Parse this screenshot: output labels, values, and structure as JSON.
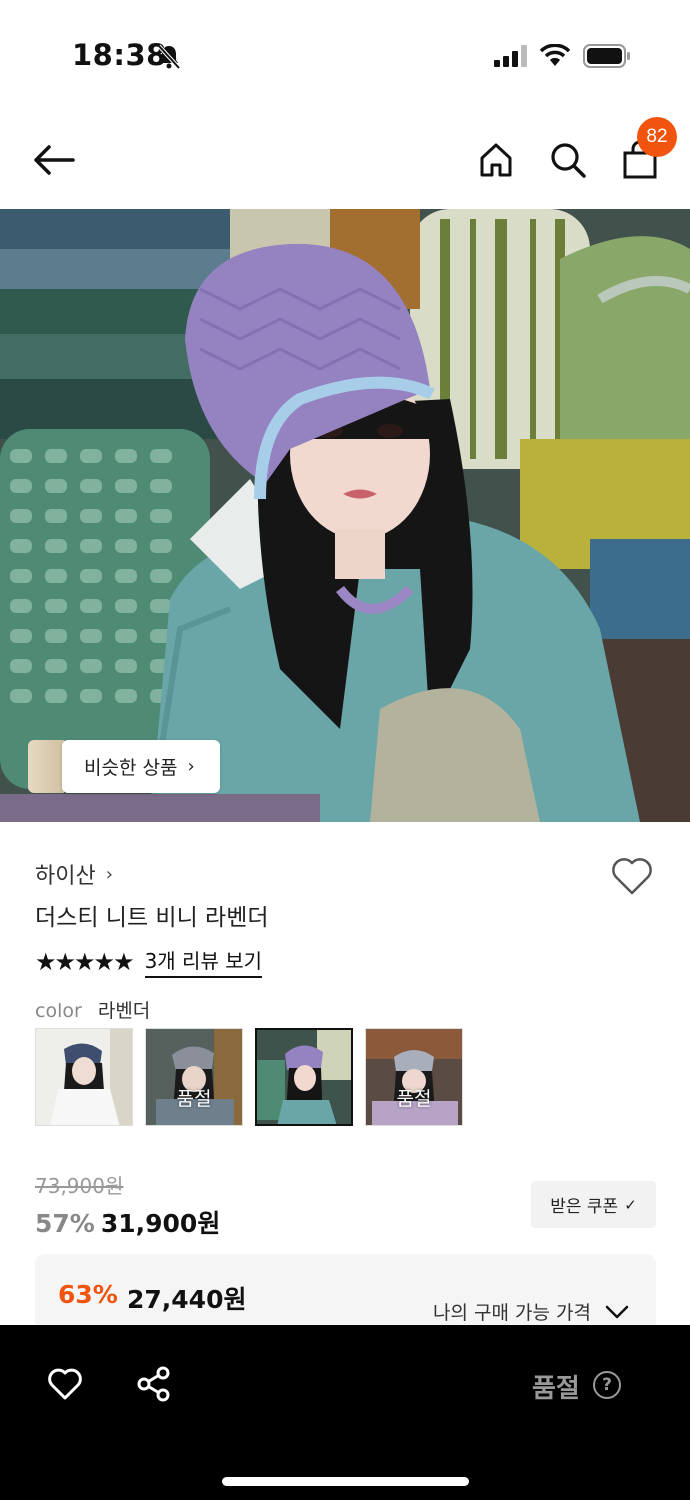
{
  "status_bar": {
    "time": "18:38",
    "icons": [
      "bell-slash-icon",
      "signal-icon",
      "wifi-icon",
      "battery-icon"
    ]
  },
  "nav": {
    "icons": [
      "back-arrow-icon",
      "home-icon",
      "search-icon",
      "shopping-bag-icon"
    ],
    "cart_count": "82"
  },
  "hero": {
    "similar_button": "비슷한 상품"
  },
  "product": {
    "brand": "하이산",
    "name": "더스티 니트 비니 라벤더",
    "rating_stars": "★★★★★",
    "rating_value": 5,
    "review_link": "3개 리뷰 보기",
    "color_label": "color",
    "color_value": "라벤더",
    "swatches": [
      {
        "status": ""
      },
      {
        "status": "품절"
      },
      {
        "status": ""
      },
      {
        "status": "품절"
      }
    ],
    "selected_swatch_index": 2
  },
  "price": {
    "original": "73,900원",
    "discount": "57%",
    "sale": "31,900원",
    "coupon_button": "받은 쿠폰",
    "my_discount": "63%",
    "my_price": "27,440원",
    "my_price_label": "나의 구매 가능 가격"
  },
  "bottom_bar": {
    "status": "품절",
    "help": "?"
  },
  "colors": {
    "accent": "#f0540f",
    "bottom_bar": "#000000",
    "sold_out_text": "#999999"
  }
}
